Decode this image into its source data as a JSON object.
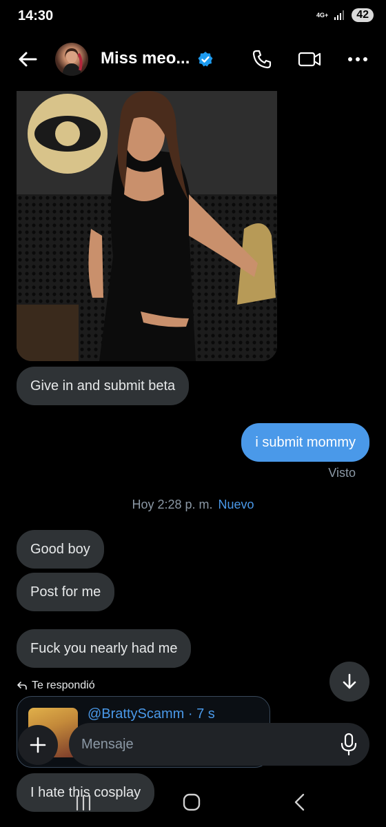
{
  "status_bar": {
    "time": "14:30",
    "network": "4G+",
    "battery": "42"
  },
  "header": {
    "contact_name": "Miss meo...",
    "icons": [
      "back-arrow-icon",
      "verified-badge-icon",
      "phone-icon",
      "video-camera-icon",
      "more-options-icon"
    ]
  },
  "messages": {
    "m1": "Give in and submit beta",
    "m2": "i submit mommy",
    "seen": "Visto",
    "day_separator": "Hoy 2:28 p. m.",
    "new_label": "Nuevo",
    "m3": "Good boy",
    "m4": "Post for me",
    "m5": "Fuck you nearly had me",
    "m6": "I hate this cosplay"
  },
  "reply": {
    "label": "Te respondió",
    "user": "@BrattyScamm · 7 s"
  },
  "composer": {
    "placeholder": "Mensaje"
  },
  "colors": {
    "accent": "#4a99e9",
    "bubble_in": "#2f3336",
    "background": "#000000"
  }
}
